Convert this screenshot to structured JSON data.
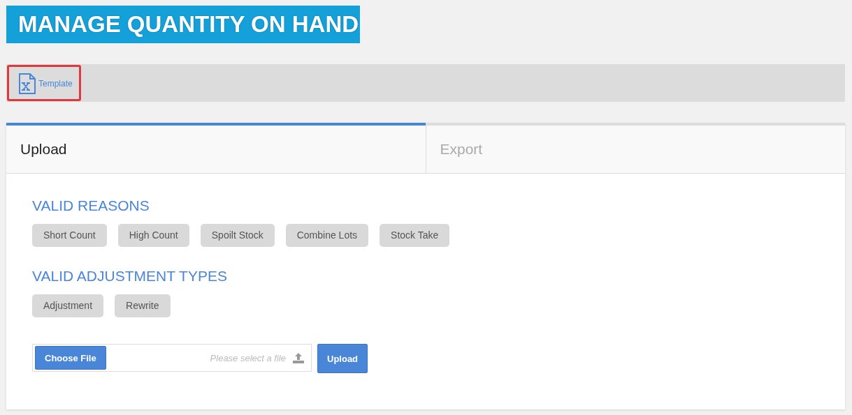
{
  "page_title": "MANAGE QUANTITY ON HAND",
  "toolbar": {
    "template_link": {
      "label": "Template",
      "highlighted": true
    }
  },
  "tabs": [
    {
      "label": "Upload",
      "selected": true
    },
    {
      "label": "Export",
      "selected": false
    }
  ],
  "sections": [
    {
      "heading": "VALID REASONS",
      "chips": [
        "Short Count",
        "High Count",
        "Spoilt Stock",
        "Combine Lots",
        "Stock Take"
      ]
    },
    {
      "heading": "VALID ADJUSTMENT TYPES",
      "chips": [
        "Adjustment",
        "Rewrite"
      ]
    }
  ],
  "file_upload": {
    "choose_label": "Choose File",
    "placeholder": "Please select a file",
    "upload_label": "Upload"
  }
}
